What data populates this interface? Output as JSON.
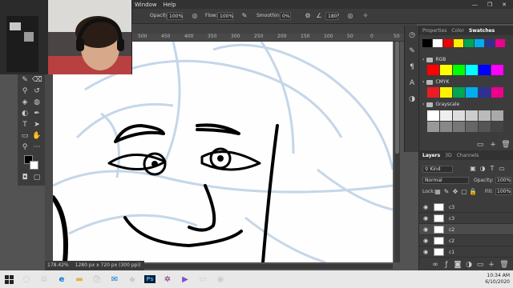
{
  "menu": {
    "window": "Window",
    "help": "Help",
    "minimize": "—",
    "maximize": "❐",
    "close": "✕"
  },
  "options": {
    "opacity_label": "Opacity:",
    "opacity_value": "100%",
    "flow_label": "Flow:",
    "flow_value": "100%",
    "smoothing_label": "Smoothing:",
    "smoothing_value": "0%",
    "angle_value": "180°"
  },
  "ruler_ticks": [
    "500",
    "450",
    "400",
    "350",
    "300",
    "250",
    "200",
    "150",
    "100",
    "50",
    "0",
    "50"
  ],
  "panels": {
    "tabs": [
      "Properties",
      "Color",
      "Swatches"
    ],
    "active_tab": "Swatches",
    "groups": [
      "RGB",
      "CMYK",
      "Grayscale"
    ]
  },
  "swatches": {
    "top_row": [
      "#000000",
      "#ffffff",
      "#f20000",
      "#ffee00",
      "#00a651",
      "#00aeef",
      "#2e3192",
      "#ec008c"
    ],
    "rgb": [
      "#ff0000",
      "#ffff00",
      "#00ff00",
      "#00ffff",
      "#0000ff",
      "#ff00ff"
    ],
    "cmyk": [
      "#ed1c24",
      "#fff200",
      "#00a651",
      "#00aeef",
      "#2e3192",
      "#ec008c"
    ],
    "grayscale": [
      "#ffffff",
      "#eeeeee",
      "#dddddd",
      "#cccccc",
      "#bbbbbb",
      "#aaaaaa",
      "#999999",
      "#888888",
      "#777777",
      "#666666",
      "#555555",
      "#444444"
    ]
  },
  "layers": {
    "tabs": [
      "Layers",
      "3D",
      "Channels"
    ],
    "filter_label": "Kind",
    "blend_mode": "Normal",
    "opacity_label": "Opacity:",
    "opacity_value": "100%",
    "lock_label": "Lock:",
    "fill_label": "Fill:",
    "fill_value": "100%",
    "items": [
      {
        "name": "c3",
        "selected": false
      },
      {
        "name": "c3",
        "selected": false
      },
      {
        "name": "c2",
        "selected": true
      },
      {
        "name": "c2",
        "selected": false
      },
      {
        "name": "c1",
        "selected": false
      }
    ]
  },
  "status": {
    "zoom": "178.42%",
    "doc_size": "1280 px x 720 px (300 ppi)"
  },
  "taskbar": {
    "time": "10:34 AM",
    "date": "6/10/2020"
  },
  "colors": {
    "ps_dark": "#323232",
    "panel": "#3c3c3c",
    "sketch_blue": "#b7cde4"
  }
}
